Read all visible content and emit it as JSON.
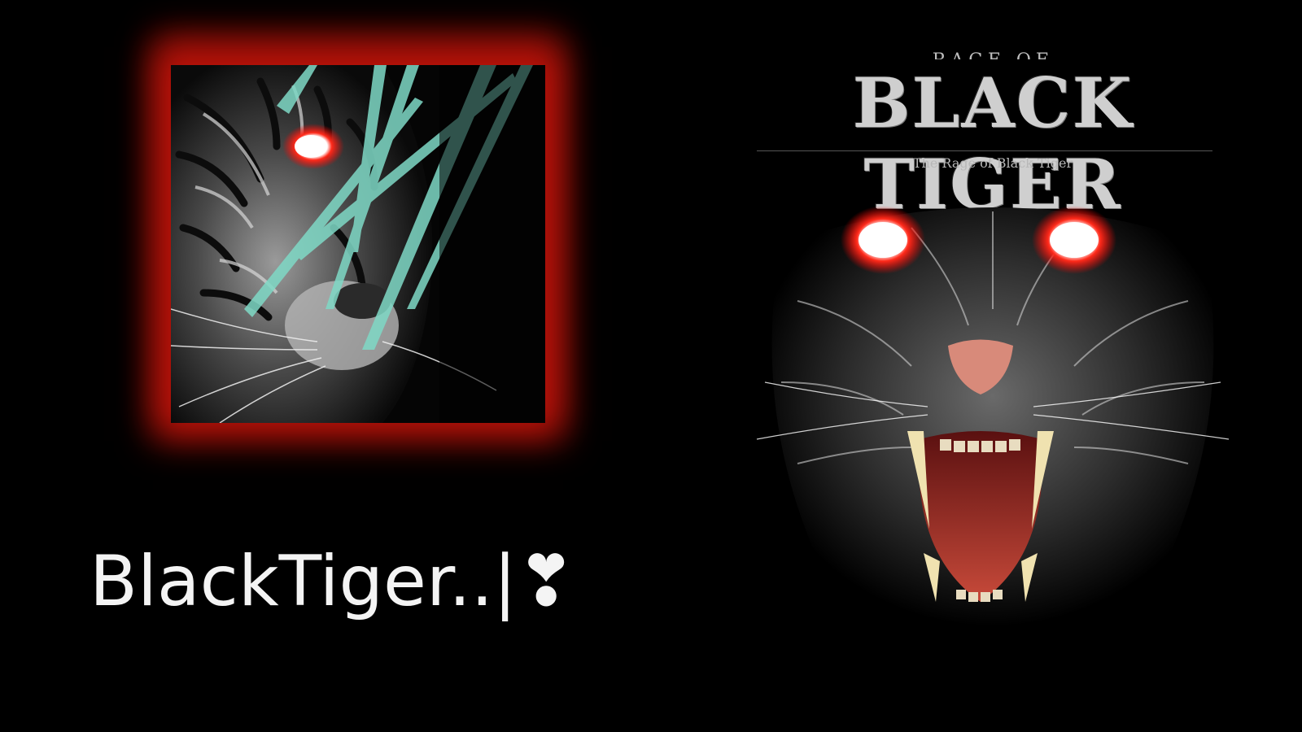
{
  "profile": {
    "name": "BlackTiger..|❣",
    "avatar_glow_color": "#c8140a"
  },
  "poster": {
    "title_top": "RAGE OF",
    "title": "BLACK TIGER",
    "subtitle": "The Rage of Black Tiger",
    "eye_color": "#ff2a1a"
  },
  "icons": {
    "avatar": "tiger-face-image",
    "poster": "roaring-tiger-image"
  }
}
